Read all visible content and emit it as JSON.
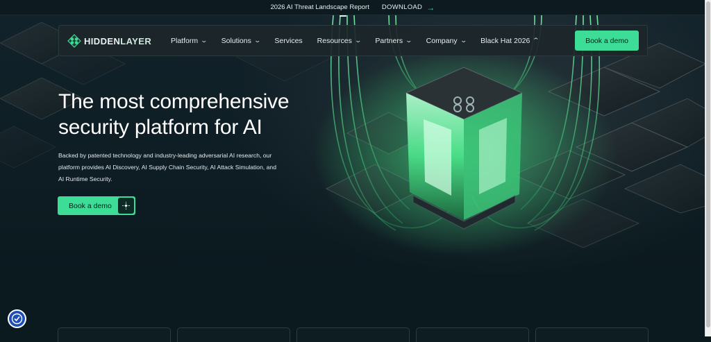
{
  "announcement": {
    "text": "2026 AI Threat Landscape Report",
    "action_label": "DOWNLOAD"
  },
  "brand": {
    "logo_part1": "HIDDEN",
    "logo_part2": "LAYER",
    "accent_color": "#3ddc97"
  },
  "nav": {
    "items": [
      {
        "label": "Platform",
        "dropdown": true
      },
      {
        "label": "Solutions",
        "dropdown": true
      },
      {
        "label": "Services",
        "dropdown": false
      },
      {
        "label": "Resources",
        "dropdown": true
      },
      {
        "label": "Partners",
        "dropdown": true
      },
      {
        "label": "Company",
        "dropdown": true
      },
      {
        "label": "Black Hat 2026",
        "dropdown": true,
        "expanded": true
      }
    ],
    "cta_label": "Book a demo"
  },
  "hero": {
    "title_line1": "The most comprehensive",
    "title_line2": "security platform for AI",
    "description": "Backed by patented technology and industry-leading adversarial AI research, our platform provides AI Discovery, AI Supply Chain Security, AI Attack Simulation, and AI Runtime Security.",
    "cta_label": "Book a demo"
  },
  "icons": {
    "download": "arrow-right-icon",
    "dropdown": "chevron-down-icon",
    "expanded": "chevron-up-icon",
    "cta": "move-icon",
    "accessibility": "accessibility-icon"
  }
}
